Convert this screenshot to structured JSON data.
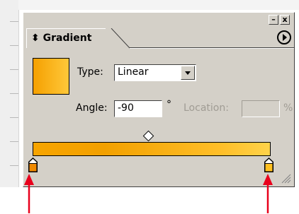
{
  "panel": {
    "tab_label": "⬍ Gradient",
    "minimize_label": "–",
    "close_label": "x"
  },
  "fields": {
    "type_label": "Type:",
    "type_value": "Linear",
    "angle_label": "Angle:",
    "angle_value": "-90",
    "degree_symbol": "°",
    "location_label": "Location:",
    "location_value": "",
    "percent_symbol": "%"
  },
  "gradient": {
    "start_color": "#f5a000",
    "end_color": "#ffd34a",
    "stop_count": 2
  },
  "colors": {
    "panel_bg": "#d4d0c8",
    "annotation_arrow": "#e8001c"
  }
}
